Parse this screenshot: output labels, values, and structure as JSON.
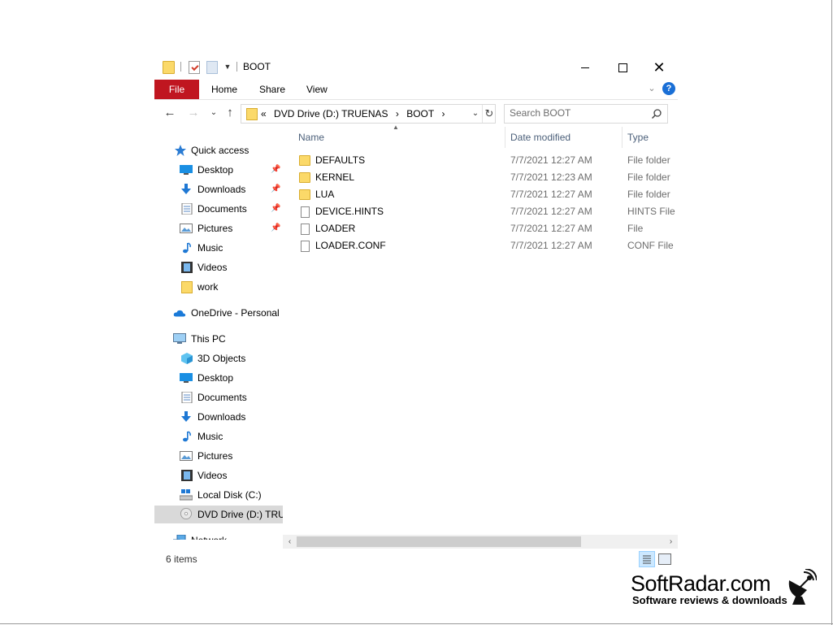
{
  "window": {
    "title": "BOOT",
    "controls": {
      "minimize": "minimize",
      "maximize": "maximize",
      "close": "✕"
    }
  },
  "ribbon": {
    "tabs": [
      "File",
      "Home",
      "Share",
      "View"
    ],
    "help": "?"
  },
  "address_bar": {
    "prefix": "«",
    "segments": [
      "DVD Drive (D:) TRUENAS",
      "BOOT"
    ],
    "separator": "›"
  },
  "search": {
    "placeholder": "Search BOOT"
  },
  "sidebar": {
    "quick_access": {
      "label": "Quick access",
      "items": [
        {
          "label": "Desktop",
          "icon": "desktop-icon",
          "pinned": true
        },
        {
          "label": "Downloads",
          "icon": "downloads-icon",
          "pinned": true
        },
        {
          "label": "Documents",
          "icon": "documents-icon",
          "pinned": true
        },
        {
          "label": "Pictures",
          "icon": "pictures-icon",
          "pinned": true
        },
        {
          "label": "Music",
          "icon": "music-icon",
          "pinned": false
        },
        {
          "label": "Videos",
          "icon": "videos-icon",
          "pinned": false
        },
        {
          "label": "work",
          "icon": "folder-icon",
          "pinned": false
        }
      ]
    },
    "onedrive": {
      "label": "OneDrive - Personal"
    },
    "this_pc": {
      "label": "This PC",
      "items": [
        {
          "label": "3D Objects",
          "icon": "3d-objects-icon"
        },
        {
          "label": "Desktop",
          "icon": "desktop-icon"
        },
        {
          "label": "Documents",
          "icon": "documents-icon"
        },
        {
          "label": "Downloads",
          "icon": "downloads-icon"
        },
        {
          "label": "Music",
          "icon": "music-icon"
        },
        {
          "label": "Pictures",
          "icon": "pictures-icon"
        },
        {
          "label": "Videos",
          "icon": "videos-icon"
        },
        {
          "label": "Local Disk (C:)",
          "icon": "local-disk-icon"
        },
        {
          "label": "DVD Drive (D:) TRUENAS",
          "icon": "dvd-drive-icon",
          "selected": true
        }
      ]
    },
    "network": {
      "label": "Network"
    }
  },
  "columns": {
    "name": "Name",
    "date": "Date modified",
    "type": "Type"
  },
  "files": [
    {
      "name": "DEFAULTS",
      "date": "7/7/2021 12:27 AM",
      "type": "File folder",
      "kind": "folder"
    },
    {
      "name": "KERNEL",
      "date": "7/7/2021 12:23 AM",
      "type": "File folder",
      "kind": "folder"
    },
    {
      "name": "LUA",
      "date": "7/7/2021 12:27 AM",
      "type": "File folder",
      "kind": "folder"
    },
    {
      "name": "DEVICE.HINTS",
      "date": "7/7/2021 12:27 AM",
      "type": "HINTS File",
      "kind": "file"
    },
    {
      "name": "LOADER",
      "date": "7/7/2021 12:27 AM",
      "type": "File",
      "kind": "file"
    },
    {
      "name": "LOADER.CONF",
      "date": "7/7/2021 12:27 AM",
      "type": "CONF File",
      "kind": "file"
    }
  ],
  "status": {
    "item_count": "6 items"
  },
  "watermark": {
    "title": "SoftRadar.com",
    "subtitle": "Software reviews & downloads"
  },
  "colors": {
    "file_tab": "#c01620",
    "folder": "#fbd969",
    "accent": "#1a6fd6",
    "selected": "#d9d9d9"
  }
}
